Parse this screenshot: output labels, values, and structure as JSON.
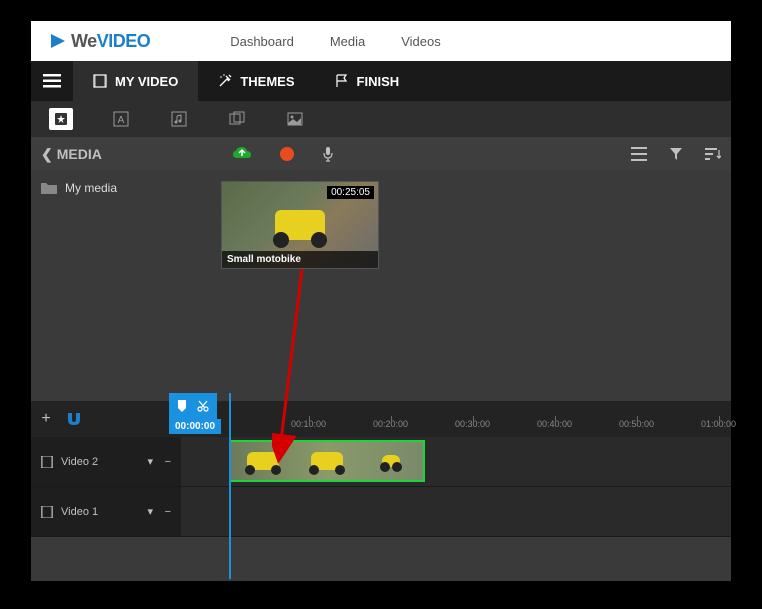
{
  "logo": {
    "we": "We",
    "video": "VIDEO"
  },
  "header_nav": {
    "dashboard": "Dashboard",
    "media": "Media",
    "videos": "Videos"
  },
  "tabs": {
    "myvideo": "MY VIDEO",
    "themes": "THEMES",
    "finish": "FINISH"
  },
  "media_back": "MEDIA",
  "folder": "My media",
  "thumb": {
    "duration": "00:25:05",
    "title": "Small motobike"
  },
  "playhead": {
    "time": "00:00:00"
  },
  "ruler": [
    "00:10:00",
    "00:20:00",
    "00:30:00",
    "00:40:00",
    "00:50:00",
    "01:00:00"
  ],
  "tracks": {
    "v2": "Video 2",
    "v1": "Video 1"
  }
}
